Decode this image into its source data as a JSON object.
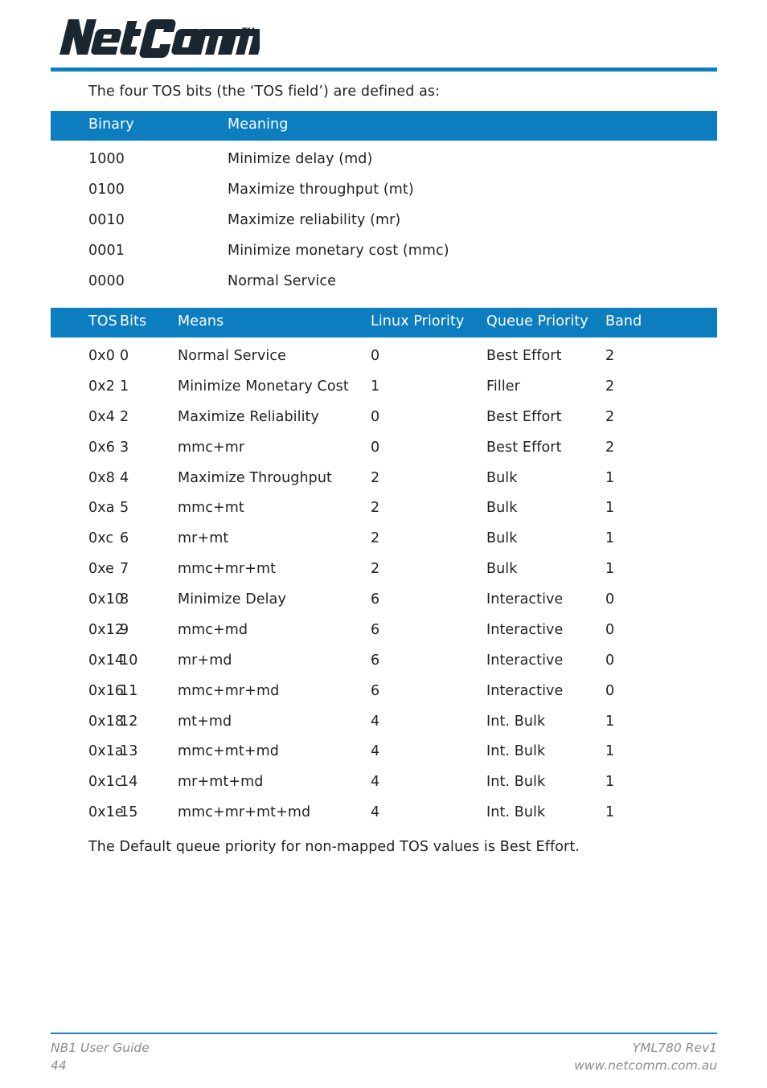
{
  "brand": {
    "logo_text": "NetComm",
    "logo_trademark": "TM",
    "accent_color": "#0c7ec0",
    "logo_color": "#1a2730"
  },
  "content": {
    "intro_paragraph": "The four TOS bits (the ‘TOS field’) are defined as:",
    "outro_paragraph": "The Default queue priority for non-mapped TOS values is Best Effort."
  },
  "tos_bits_table": {
    "headers": [
      "Binary",
      "Meaning"
    ],
    "rows": [
      [
        "1000",
        "Minimize delay (md)"
      ],
      [
        "0100",
        "Maximize throughput (mt)"
      ],
      [
        "0010",
        "Maximize reliability (mr)"
      ],
      [
        "0001",
        "Minimize monetary cost (mmc)"
      ],
      [
        "0000",
        "Normal Service"
      ]
    ]
  },
  "tos_map_table": {
    "headers": [
      "TOS",
      "Bits",
      "Means",
      "Linux Priority",
      "Queue Priority",
      "Band"
    ],
    "rows": [
      [
        "0x0",
        "0",
        "Normal Service",
        "0",
        "Best Effort",
        "2"
      ],
      [
        "0x2",
        "1",
        "Minimize Monetary Cost",
        "1",
        "Filler",
        "2"
      ],
      [
        "0x4",
        "2",
        "Maximize Reliability",
        "0",
        "Best Effort",
        "2"
      ],
      [
        "0x6",
        "3",
        "mmc+mr",
        "0",
        "Best Effort",
        "2"
      ],
      [
        "0x8",
        "4",
        "Maximize Throughput",
        "2",
        "Bulk",
        "1"
      ],
      [
        "0xa",
        "5",
        "mmc+mt",
        "2",
        "Bulk",
        "1"
      ],
      [
        "0xc",
        "6",
        "mr+mt",
        "2",
        "Bulk",
        "1"
      ],
      [
        "0xe",
        "7",
        "mmc+mr+mt",
        "2",
        "Bulk",
        "1"
      ],
      [
        "0x10",
        "8",
        "Minimize Delay",
        "6",
        "Interactive",
        "0"
      ],
      [
        "0x12",
        "9",
        "mmc+md",
        "6",
        "Interactive",
        "0"
      ],
      [
        "0x14",
        "10",
        "mr+md",
        "6",
        "Interactive",
        "0"
      ],
      [
        "0x16",
        "11",
        "mmc+mr+md",
        "6",
        "Interactive",
        "0"
      ],
      [
        "0x18",
        "12",
        "mt+md",
        "4",
        "Int. Bulk",
        "1"
      ],
      [
        "0x1a",
        "13",
        "mmc+mt+md",
        "4",
        "Int. Bulk",
        "1"
      ],
      [
        "0x1c",
        "14",
        "mr+mt+md",
        "4",
        "Int. Bulk",
        "1"
      ],
      [
        "0x1e",
        "15",
        "mmc+mr+mt+md",
        "4",
        "Int. Bulk",
        "1"
      ]
    ]
  },
  "footer": {
    "document_title": "NB1 User Guide",
    "page_number": "44",
    "revision": "YML780 Rev1",
    "website": "www.netcomm.com.au"
  }
}
